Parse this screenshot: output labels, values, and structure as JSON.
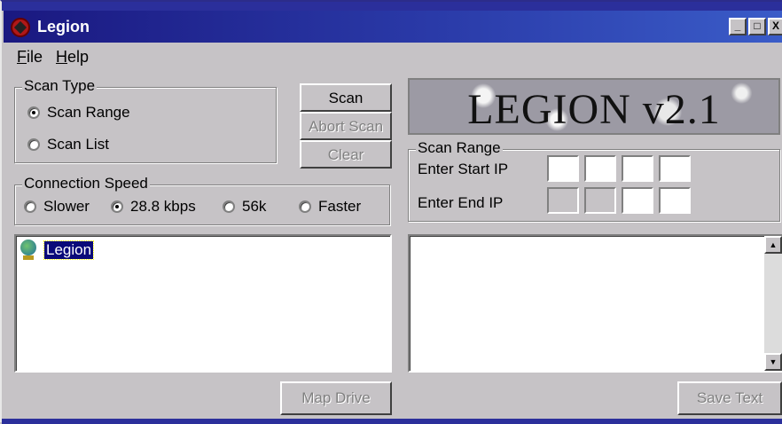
{
  "window": {
    "title": "Legion",
    "controls": {
      "minimize": "_",
      "maximize": "□",
      "close": "X"
    }
  },
  "menu": {
    "file": "File",
    "help": "Help"
  },
  "scan_type": {
    "label": "Scan Type",
    "options": [
      {
        "label": "Scan Range",
        "selected": true
      },
      {
        "label": "Scan List",
        "selected": false
      }
    ]
  },
  "buttons": {
    "scan": "Scan",
    "abort_scan": "Abort Scan",
    "clear": "Clear",
    "map_drive": "Map Drive",
    "save_text": "Save Text"
  },
  "logo": {
    "text": "LEGION v2.1"
  },
  "connection_speed": {
    "label": "Connection Speed",
    "options": [
      {
        "label": "Slower",
        "selected": false
      },
      {
        "label": "28.8 kbps",
        "selected": true
      },
      {
        "label": "56k",
        "selected": false
      },
      {
        "label": "Faster",
        "selected": false
      }
    ]
  },
  "scan_range": {
    "label": "Scan Range",
    "start_label": "Enter Start IP",
    "end_label": "Enter End IP"
  },
  "tree": {
    "root_label": "Legion"
  },
  "colors": {
    "titlebar": "#1a1880",
    "window_bg": "#c6c3c6",
    "selection": "#0a0a7a"
  }
}
